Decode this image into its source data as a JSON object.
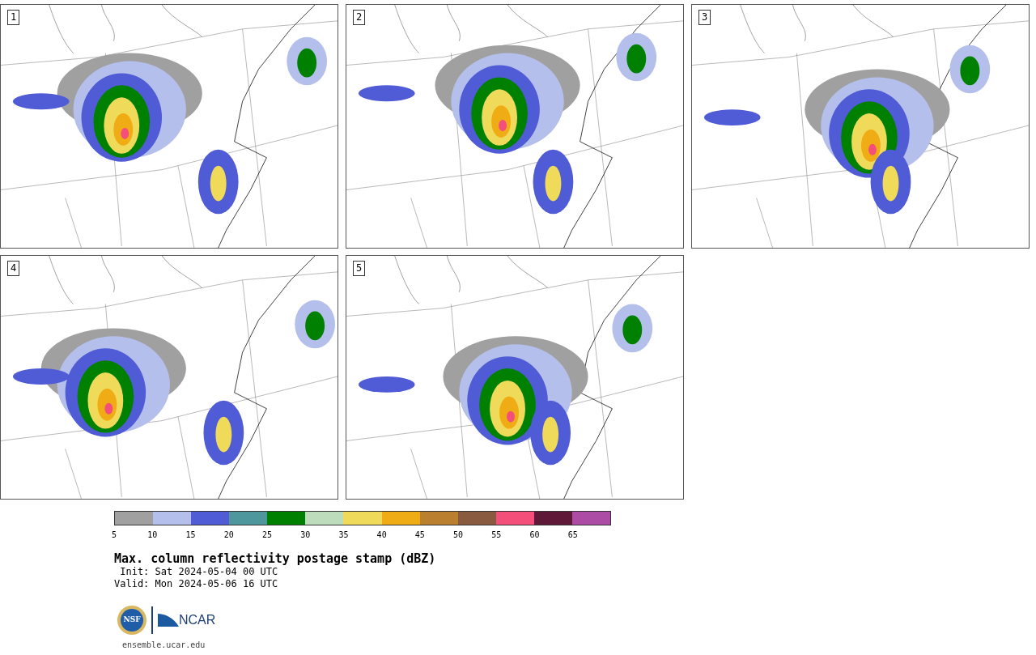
{
  "panels": [
    {
      "label": "1"
    },
    {
      "label": "2"
    },
    {
      "label": "3"
    },
    {
      "label": "4"
    },
    {
      "label": "5"
    }
  ],
  "colorbar": [
    {
      "label": "5",
      "color": "#a0a0a0"
    },
    {
      "label": "10",
      "color": "#b4bfec"
    },
    {
      "label": "15",
      "color": "#505bd6"
    },
    {
      "label": "20",
      "color": "#4e979c"
    },
    {
      "label": "25",
      "color": "#008000"
    },
    {
      "label": "30",
      "color": "#bcdcbc"
    },
    {
      "label": "35",
      "color": "#f0da5a"
    },
    {
      "label": "40",
      "color": "#f0ac14"
    },
    {
      "label": "45",
      "color": "#ba8030"
    },
    {
      "label": "50",
      "color": "#8a5a40"
    },
    {
      "label": "55",
      "color": "#f44e7a"
    },
    {
      "label": "60",
      "color": "#601838"
    },
    {
      "label": "65",
      "color": "#ac4ca4"
    }
  ],
  "title": "Max. column reflectivity postage stamp (dBZ)",
  "init": " Init: Sat 2024-05-04 00 UTC",
  "valid": "Valid: Mon 2024-05-06 16 UTC",
  "logo": {
    "nsf": "NSF",
    "ncar": "NCAR"
  },
  "footer": "ensemble.ucar.edu"
}
